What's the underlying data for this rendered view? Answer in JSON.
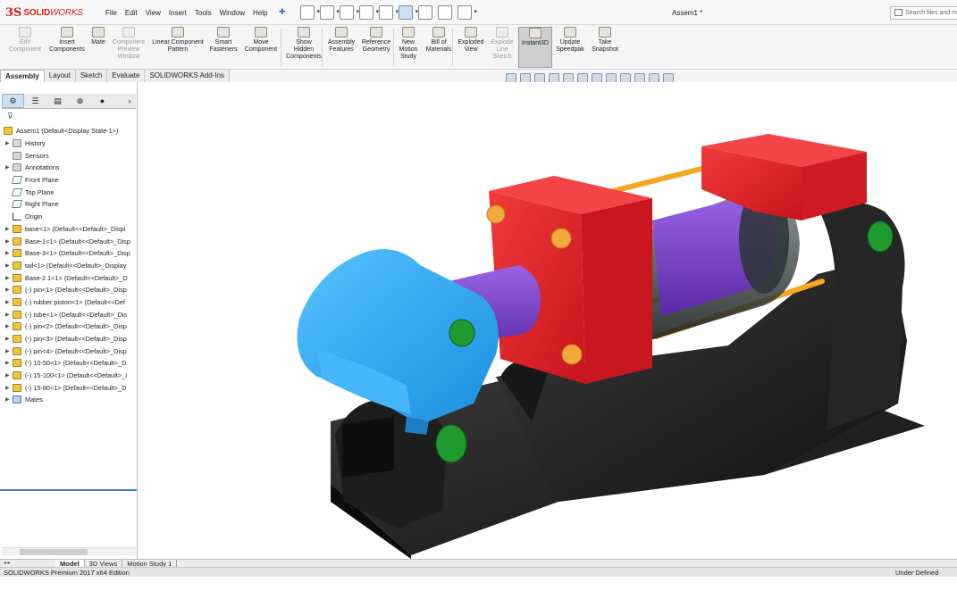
{
  "app": {
    "logo_prefix": "3S",
    "logo_brand": "SOLID",
    "logo_brand_italic": "WORKS",
    "document_title": "Assem1 *"
  },
  "menu": [
    "File",
    "Edit",
    "View",
    "Insert",
    "Tools",
    "Window",
    "Help"
  ],
  "search": {
    "placeholder": "Search files and m"
  },
  "ribbon": {
    "buttons": [
      {
        "name": "edit-component-button",
        "label": "Edit Component",
        "lines": [
          "Edit",
          "Component"
        ],
        "disabled": true
      },
      {
        "name": "insert-components-button",
        "label": "Insert Components",
        "lines": [
          "Insert",
          "Components"
        ],
        "disabled": false
      },
      {
        "name": "mate-button",
        "label": "Mate",
        "lines": [
          "Mate"
        ],
        "disabled": false
      },
      {
        "name": "component-preview-window-button",
        "label": "Component Preview Window",
        "lines": [
          "Component",
          "Preview",
          "Window"
        ],
        "disabled": true
      },
      {
        "name": "linear-component-pattern-button",
        "label": "Linear Component Pattern",
        "lines": [
          "Linear Component",
          "Pattern"
        ],
        "disabled": false
      },
      {
        "name": "smart-fasteners-button",
        "label": "Smart Fasteners",
        "lines": [
          "Smart",
          "Fasteners"
        ],
        "disabled": false
      },
      {
        "name": "move-component-button",
        "label": "Move Component",
        "lines": [
          "Move",
          "Component"
        ],
        "disabled": false
      },
      {
        "name": "show-hidden-components-button",
        "label": "Show Hidden Components",
        "lines": [
          "Show",
          "Hidden",
          "Components"
        ],
        "disabled": false
      },
      {
        "name": "assembly-features-button",
        "label": "Assembly Features",
        "lines": [
          "Assembly",
          "Features"
        ],
        "disabled": false
      },
      {
        "name": "reference-geometry-button",
        "label": "Reference Geometry",
        "lines": [
          "Reference",
          "Geometry"
        ],
        "disabled": false
      },
      {
        "name": "new-motion-study-button",
        "label": "New Motion Study",
        "lines": [
          "New",
          "Motion",
          "Study"
        ],
        "disabled": false
      },
      {
        "name": "bill-of-materials-button",
        "label": "Bill of Materials",
        "lines": [
          "Bill of",
          "Materials"
        ],
        "disabled": false
      },
      {
        "name": "exploded-view-button",
        "label": "Exploded View",
        "lines": [
          "Exploded",
          "View"
        ],
        "disabled": false
      },
      {
        "name": "explode-line-sketch-button",
        "label": "Explode Line Sketch",
        "lines": [
          "Explode",
          "Line",
          "Sketch"
        ],
        "disabled": true
      },
      {
        "name": "instant3d-button",
        "label": "Instant3D",
        "lines": [
          "Instant3D"
        ],
        "disabled": false,
        "active": true
      },
      {
        "name": "update-speedpak-button",
        "label": "Update Speedpak",
        "lines": [
          "Update",
          "Speedpak"
        ],
        "disabled": false
      },
      {
        "name": "take-snapshot-button",
        "label": "Take Snapshot",
        "lines": [
          "Take",
          "Snapshot"
        ],
        "disabled": false
      }
    ]
  },
  "command_tabs": [
    "Assembly",
    "Layout",
    "Sketch",
    "Evaluate",
    "SOLIDWORKS Add-Ins"
  ],
  "feature_tree": {
    "root": "Assem1  (Default<Display State-1>)",
    "items": [
      {
        "label": "History",
        "icon": "folder-icon",
        "exp": true
      },
      {
        "label": "Sensors",
        "icon": "folder-icon",
        "exp": false
      },
      {
        "label": "Annotations",
        "icon": "folder-icon",
        "exp": true
      },
      {
        "label": "Front Plane",
        "icon": "plane-icon",
        "exp": false
      },
      {
        "label": "Top Plane",
        "icon": "plane-icon",
        "exp": false
      },
      {
        "label": "Right Plane",
        "icon": "plane-icon",
        "exp": false
      },
      {
        "label": "Origin",
        "icon": "origin-icon",
        "exp": false
      },
      {
        "label": "base<1> (Default<<Default>_Displ",
        "icon": "part-icon",
        "exp": true
      },
      {
        "label": "Base-1<1> (Default<<Default>_Disp",
        "icon": "part-icon",
        "exp": true
      },
      {
        "label": "Base-3<1> (Default<<Default>_Disp",
        "icon": "part-icon",
        "exp": true
      },
      {
        "label": "tail<1> (Default<<Default>_Display",
        "icon": "part-icon",
        "exp": true
      },
      {
        "label": "Base-2.1<1> (Default<<Default>_D",
        "icon": "part-icon",
        "exp": true
      },
      {
        "label": "(-) pin<1> (Default<<Default>_Disp",
        "icon": "part-icon",
        "exp": true
      },
      {
        "label": "(-) rubber piston<1> (Default<<Def",
        "icon": "part-icon",
        "exp": true
      },
      {
        "label": "(-) tube<1> (Default<<Default>_Dis",
        "icon": "part-icon",
        "exp": true
      },
      {
        "label": "(-) pin<2> (Default<<Default>_Disp",
        "icon": "part-icon",
        "exp": true
      },
      {
        "label": "(-) pin<3> (Default<<Default>_Disp",
        "icon": "part-icon",
        "exp": true
      },
      {
        "label": "(-) pin<4> (Default<<Default>_Disp",
        "icon": "part-icon",
        "exp": true
      },
      {
        "label": "(-) 10-50<1> (Default<<Default>_D",
        "icon": "part-icon",
        "exp": true
      },
      {
        "label": "(-) 15-100<1> (Default<<Default>_I",
        "icon": "part-icon",
        "exp": true
      },
      {
        "label": "(-) 15-80<1> (Default<<Default>_D",
        "icon": "part-icon",
        "exp": true
      },
      {
        "label": "Mates",
        "icon": "mates-icon",
        "exp": true
      }
    ]
  },
  "bottom_tabs": [
    "Model",
    "3D Views",
    "Motion Study 1"
  ],
  "status": {
    "left": "SOLIDWORKS Premium 2017 x64 Edition",
    "right": "Under Defined"
  },
  "colors": {
    "red_block": "#e8202a",
    "black_base": "#1c1c1c",
    "blue_clevis": "#2aa6f0",
    "purple_piston": "#7b3fc8",
    "orange_rods": "#f5a623",
    "green_pins": "#1f9a2e"
  }
}
